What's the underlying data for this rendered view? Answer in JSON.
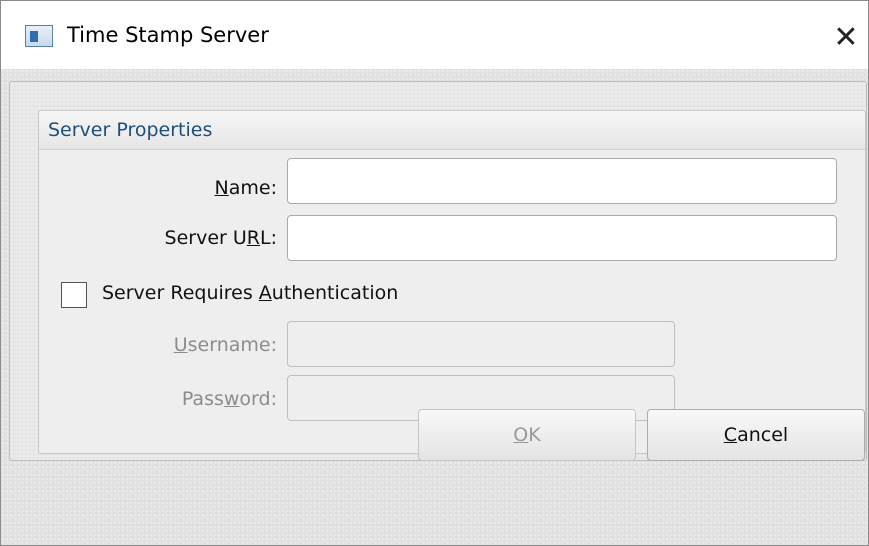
{
  "window": {
    "title": "Time Stamp Server",
    "close_glyph": "✕"
  },
  "group": {
    "title": "Server Properties"
  },
  "fields": {
    "name": {
      "label_pre": "",
      "label_u": "N",
      "label_post": "ame:",
      "value": ""
    },
    "server_url": {
      "label_pre": "Server U",
      "label_u": "R",
      "label_post": "L:",
      "value": ""
    },
    "username": {
      "label_pre": "",
      "label_u": "U",
      "label_post": "sername:",
      "value": ""
    },
    "password": {
      "label_pre": "Pass",
      "label_u": "w",
      "label_post": "ord:",
      "value": ""
    }
  },
  "auth_checkbox": {
    "label_pre": "Server Requires ",
    "label_u": "A",
    "label_post": "uthentication",
    "checked": false
  },
  "buttons": {
    "ok": {
      "label_u": "O",
      "label_post": "K"
    },
    "cancel": {
      "label_u": "C",
      "label_post": "ancel"
    }
  }
}
